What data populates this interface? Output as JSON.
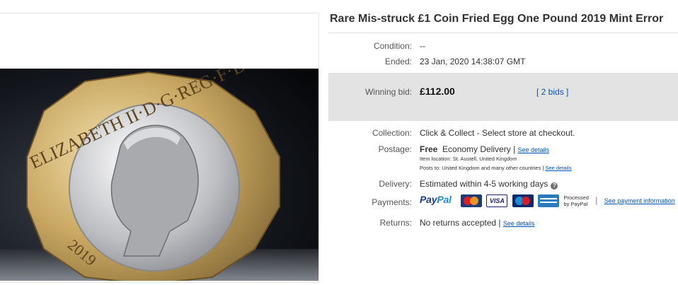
{
  "listing": {
    "title": "Rare Mis-struck £1 Coin Fried Egg One Pound 2019 Mint Error",
    "image_alt": "coin photo",
    "coin_inscription": "ELIZABETH II·D·G·REG·F·D",
    "coin_year": "2019"
  },
  "details": {
    "condition_label": "Condition:",
    "condition_value": "--",
    "ended_label": "Ended:",
    "ended_value": "23 Jan, 2020  14:38:07 GMT",
    "winning_label": "Winning bid:",
    "winning_price": "£112.00",
    "bids": "[ 2 bids ]",
    "collection_label": "Collection:",
    "collection_value": "Click & Collect - Select store at checkout.",
    "postage_label": "Postage:",
    "postage_free": "Free",
    "postage_service": "Economy Delivery",
    "postage_sep": "|",
    "see_details": "See details",
    "item_location": "Item location:  St. Austell, United Kingdom",
    "posts_to": "Posts to:  United Kingdom and many other countries",
    "delivery_label": "Delivery:",
    "delivery_value": "Estimated within 4-5 working days",
    "payments_label": "Payments:",
    "paypal_a": "Pay",
    "paypal_b": "Pal",
    "visa": "VISA",
    "processed_1": "Processed",
    "processed_2": "by PayPal",
    "see_payment": "See payment information",
    "returns_label": "Returns:",
    "returns_value": "No returns accepted"
  },
  "colors": {
    "link": "#0654ba",
    "band": "#e3e3e3"
  }
}
